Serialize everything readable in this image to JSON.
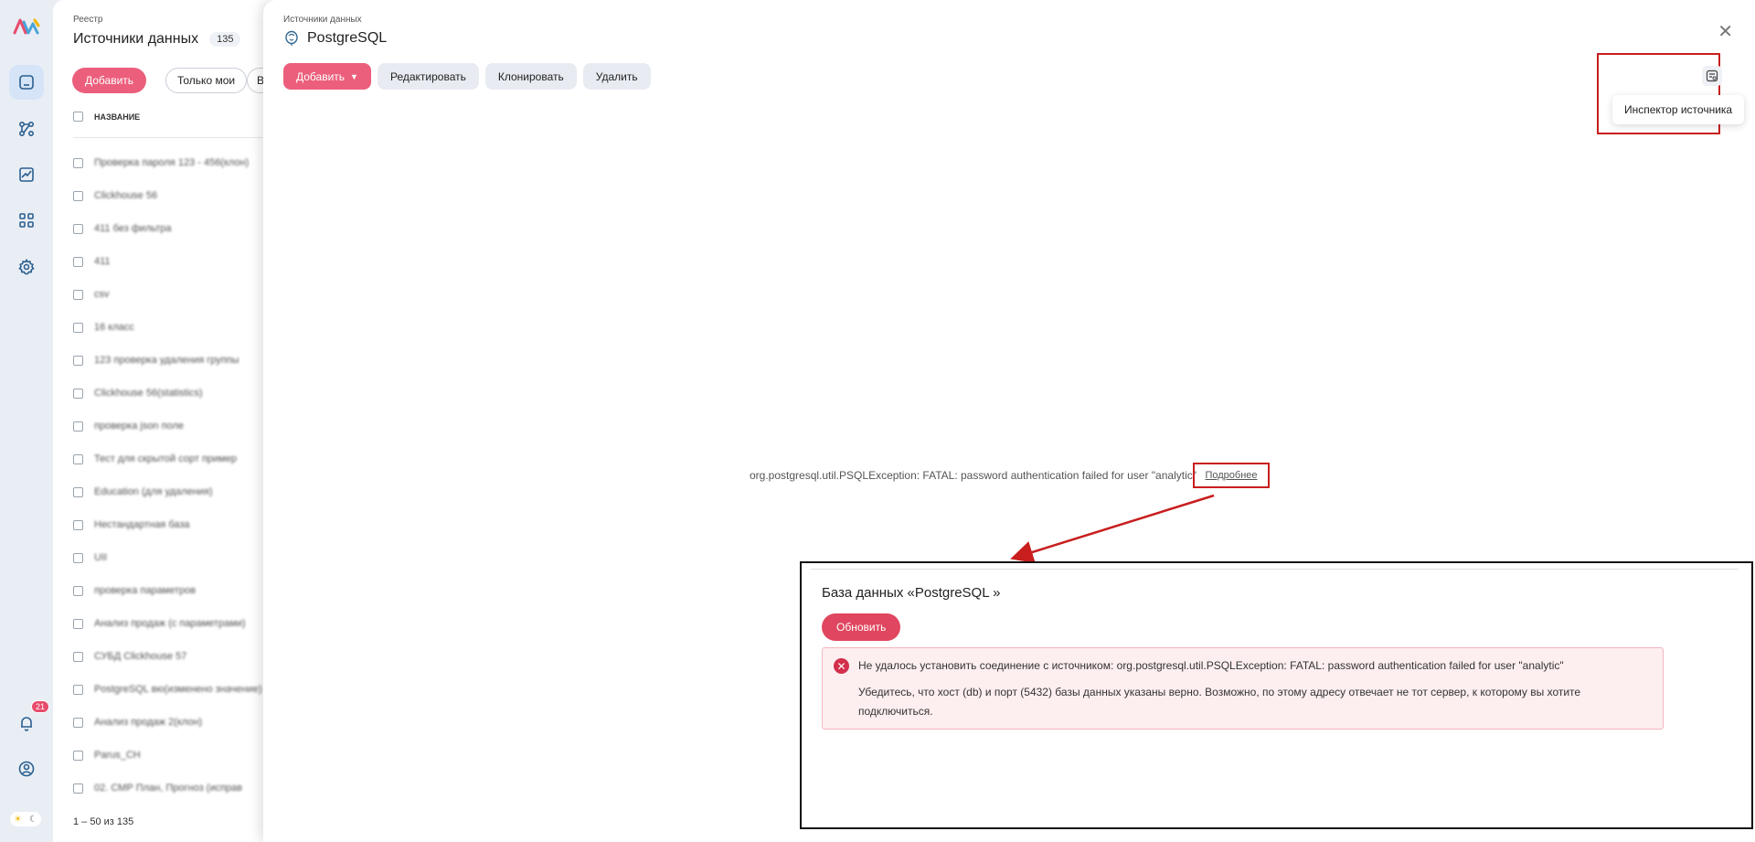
{
  "rail": {
    "notifications_count": "21",
    "items": [
      "registry-icon",
      "lineage-icon",
      "chart-icon",
      "apps-icon",
      "settings-icon"
    ]
  },
  "registry": {
    "breadcrumb": "Реестр",
    "title": "Источники данных",
    "count": "135",
    "add_label": "Добавить",
    "only_mine_label": "Только мои",
    "more_label": "В",
    "column_name": "НАЗВАНИЕ",
    "rows": [
      "Проверка пароля 123 - 456(клон)",
      "Clickhouse 56",
      "411 без фильтра",
      "411",
      "csv",
      "16 класс",
      "123 проверка удаления группы",
      "Clickhouse 56(statistics)",
      "проверка json поле",
      "Тест для скрытой сорт пример",
      "Education (для удаления)",
      "Нестандартная база",
      "UII",
      "проверка параметров",
      "Анализ продаж (с параметрами)",
      "СУБД Clickhouse 57",
      "PostgreSQL вю(изменено значение)",
      "Анализ продаж 2(клон)",
      "Parus_CH",
      "02. СМР План, Прогноз (исправ"
    ],
    "pagination": "1 – 50 из 135"
  },
  "detail": {
    "breadcrumb": "Источники данных",
    "title": "PostgreSQL",
    "toolbar": {
      "add_label": "Добавить",
      "edit_label": "Редактировать",
      "clone_label": "Клонировать",
      "delete_label": "Удалить"
    },
    "inspector_tooltip": "Инспектор источника",
    "error_text": "org.postgresql.util.PSQLException: FATAL: password authentication failed for user \"analytic\"",
    "more_link": "Подробнее"
  },
  "callout": {
    "title": "База данных «PostgreSQL »",
    "refresh_label": "Обновить",
    "alert_main": "Не удалось установить соединение с источником: org.postgresql.util.PSQLException: FATAL: password authentication failed for user \"analytic\"",
    "alert_hint": "Убедитесь, что хост (db) и порт (5432) базы данных указаны верно. Возможно, по этому адресу отвечает не тот сервер, к которому вы хотите подключиться."
  },
  "colors": {
    "accent": "#ec5f7c",
    "annotation_red": "#c81e1e",
    "alert_bg": "#fdeef0"
  }
}
